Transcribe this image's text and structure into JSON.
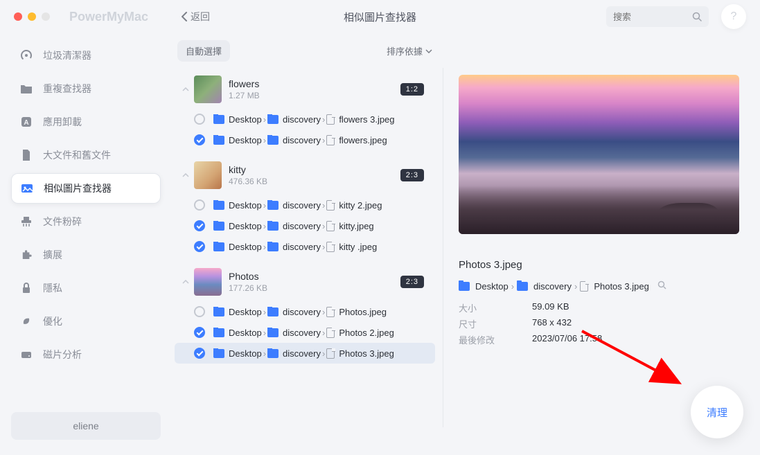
{
  "app": {
    "name": "PowerMyMac",
    "back": "返回",
    "title": "相似圖片查找器",
    "search_placeholder": "搜索",
    "help": "?"
  },
  "sidebar": {
    "items": [
      {
        "label": "垃圾清潔器"
      },
      {
        "label": "重複查找器"
      },
      {
        "label": "應用卸載"
      },
      {
        "label": "大文件和舊文件"
      },
      {
        "label": "相似圖片查找器"
      },
      {
        "label": "文件粉碎"
      },
      {
        "label": "擴展"
      },
      {
        "label": "隱私"
      },
      {
        "label": "優化"
      },
      {
        "label": "磁片分析"
      }
    ],
    "user": "eliene"
  },
  "toolbar": {
    "auto_select": "自動選擇",
    "sort": "排序依據"
  },
  "groups": [
    {
      "name": "flowers",
      "size": "1.27 MB",
      "badge": "1:2",
      "files": [
        {
          "checked": false,
          "path": [
            "Desktop",
            "discovery"
          ],
          "file": "flowers 3.jpeg"
        },
        {
          "checked": true,
          "path": [
            "Desktop",
            "discovery"
          ],
          "file": "flowers.jpeg"
        }
      ]
    },
    {
      "name": "kitty",
      "size": "476.36 KB",
      "badge": "2:3",
      "files": [
        {
          "checked": false,
          "path": [
            "Desktop",
            "discovery"
          ],
          "file": "kitty 2.jpeg"
        },
        {
          "checked": true,
          "path": [
            "Desktop",
            "discovery"
          ],
          "file": "kitty.jpeg"
        },
        {
          "checked": true,
          "path": [
            "Desktop",
            "discovery"
          ],
          "file": "kitty .jpeg"
        }
      ]
    },
    {
      "name": "Photos",
      "size": "177.26 KB",
      "badge": "2:3",
      "files": [
        {
          "checked": false,
          "path": [
            "Desktop",
            "discovery"
          ],
          "file": "Photos.jpeg"
        },
        {
          "checked": true,
          "path": [
            "Desktop",
            "discovery"
          ],
          "file": "Photos 2.jpeg"
        },
        {
          "checked": true,
          "path": [
            "Desktop",
            "discovery"
          ],
          "file": "Photos 3.jpeg",
          "selected": true
        }
      ]
    }
  ],
  "preview": {
    "filename": "Photos 3.jpeg",
    "path": [
      "Desktop",
      "discovery"
    ],
    "file": "Photos 3.jpeg",
    "meta": [
      {
        "label": "大小",
        "value": "59.09 KB"
      },
      {
        "label": "尺寸",
        "value": "768 x 432"
      },
      {
        "label": "最後修改",
        "value": "2023/07/06 17:58"
      }
    ]
  },
  "clean_button": "清理"
}
